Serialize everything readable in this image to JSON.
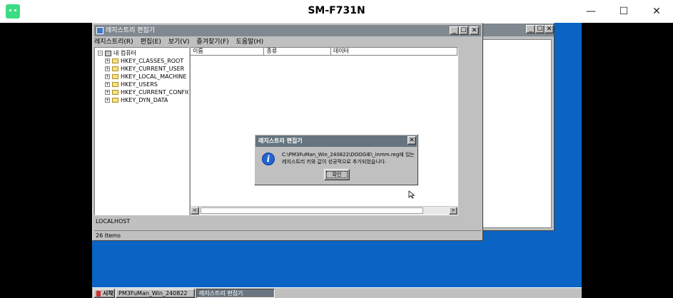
{
  "host": {
    "title": "SM-F731N",
    "min_glyph": "—",
    "max_glyph": "☐",
    "close_glyph": "✕"
  },
  "main_window": {
    "title": "레지스트리 편집기",
    "caption_buttons": [
      "_",
      "☐",
      "✕"
    ],
    "menu": [
      "레지스트리(R)",
      "편집(E)",
      "보기(V)",
      "즐겨찾기(F)",
      "도움말(H)"
    ],
    "tree": {
      "root_label": "내 컴퓨터",
      "root_toggle": "−",
      "item_toggle": "+",
      "items": [
        "HKEY_CLASSES_ROOT",
        "HKEY_CURRENT_USER",
        "HKEY_LOCAL_MACHINE",
        "HKEY_USERS",
        "HKEY_CURRENT_CONFIG",
        "HKEY_DYN_DATA"
      ]
    },
    "list_columns": [
      "이름",
      "종류",
      "데이터"
    ],
    "status_host": "LOCALHOST",
    "status_items": "26 Items"
  },
  "back_window": {
    "caption_buttons": [
      "_",
      "☐",
      "✕"
    ]
  },
  "dialog": {
    "title": "레지스트리 편집기",
    "icon_glyph": "i",
    "message": "C:\\PM3FuMan_Win_240822\\DOOGIE\\_inmm.reg에 있는 레지스트리 키와 값이 성공적으로 추가되었습니다.",
    "ok_label": "확인",
    "close_glyph": "✕"
  },
  "taskbar": {
    "start_label": "시작",
    "tasks": [
      "PM3FuMan_Win_240822",
      "레지스트리 편집기"
    ]
  },
  "colors": {
    "desktop": "#0a64c3",
    "caption": "#808890",
    "dialog_caption": "#65747f",
    "window_face": "#c0c0c0"
  }
}
